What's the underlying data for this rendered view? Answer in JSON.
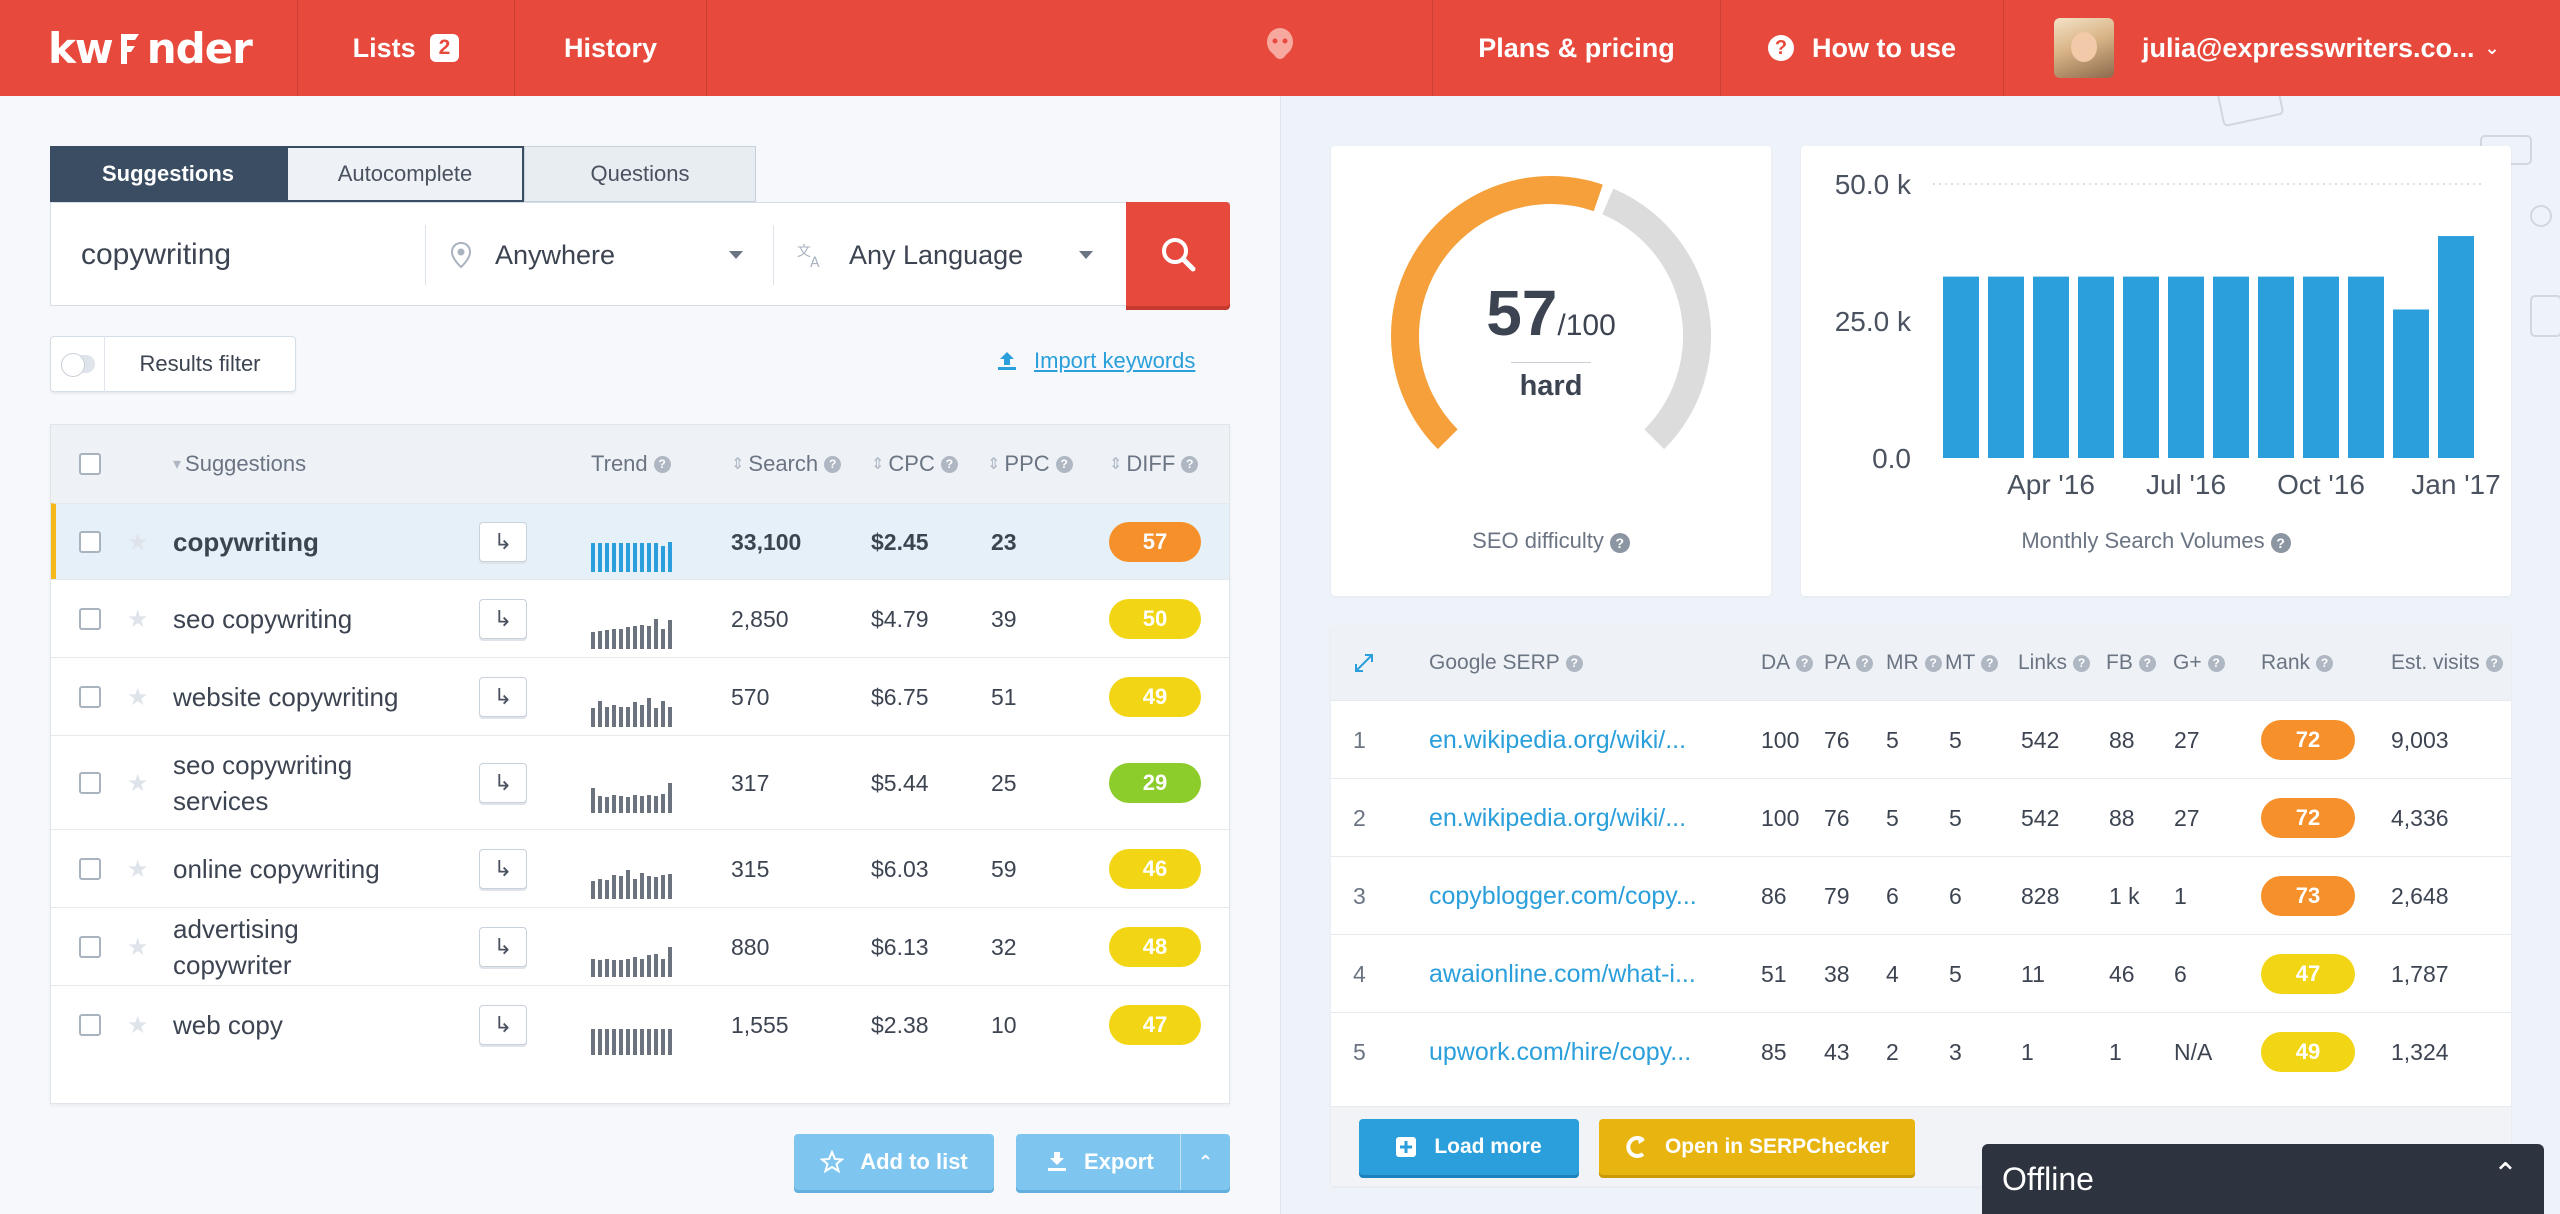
{
  "header": {
    "logo_text": "kwFinder",
    "nav": {
      "lists_label": "Lists",
      "lists_count": "2",
      "history_label": "History",
      "plans_label": "Plans & pricing",
      "howto_label": "How to use",
      "user_email": "julia@expresswriters.co..."
    },
    "brand_color": "#e8493d"
  },
  "search": {
    "tabs": [
      "Suggestions",
      "Autocomplete",
      "Questions"
    ],
    "active_tab": "Suggestions",
    "keyword": "copywriting",
    "location": "Anywhere",
    "language": "Any Language"
  },
  "filter": {
    "label": "Results filter",
    "import_label": "Import keywords"
  },
  "suggestions_table": {
    "columns": {
      "suggestions": "Suggestions",
      "trend": "Trend",
      "search": "Search",
      "cpc": "CPC",
      "ppc": "PPC",
      "diff": "DIFF"
    },
    "rows": [
      {
        "keyword": "copywriting",
        "search": "33,100",
        "cpc": "$2.45",
        "ppc": "23",
        "diff": "57",
        "diff_color": "#f5902a",
        "selected": true,
        "trend": [
          0.95,
          0.95,
          0.95,
          0.95,
          0.95,
          0.95,
          0.95,
          0.95,
          0.95,
          0.95,
          0.82,
          1.0
        ]
      },
      {
        "keyword": "seo copywriting",
        "search": "2,850",
        "cpc": "$4.79",
        "ppc": "39",
        "diff": "50",
        "diff_color": "#f2d616",
        "selected": false,
        "trend": [
          0.45,
          0.5,
          0.55,
          0.6,
          0.6,
          0.65,
          0.7,
          0.75,
          0.7,
          1.0,
          0.6,
          0.95
        ]
      },
      {
        "keyword": "website copywriting",
        "search": "570",
        "cpc": "$6.75",
        "ppc": "51",
        "diff": "49",
        "diff_color": "#f2d616",
        "selected": false,
        "trend": [
          0.55,
          0.85,
          0.6,
          0.65,
          0.6,
          0.6,
          0.8,
          0.65,
          0.95,
          0.55,
          0.85,
          0.6
        ]
      },
      {
        "keyword": "seo copywriting services",
        "search": "317",
        "cpc": "$5.44",
        "ppc": "25",
        "diff": "29",
        "diff_color": "#8ccc2b",
        "selected": false,
        "trend": [
          0.8,
          0.45,
          0.4,
          0.5,
          0.45,
          0.4,
          0.5,
          0.45,
          0.5,
          0.45,
          0.55,
          1.0
        ]
      },
      {
        "keyword": "online copywriting",
        "search": "315",
        "cpc": "$6.03",
        "ppc": "59",
        "diff": "46",
        "diff_color": "#f2d616",
        "selected": false,
        "trend": [
          0.5,
          0.6,
          0.55,
          0.75,
          0.7,
          0.95,
          0.6,
          0.85,
          0.7,
          0.65,
          0.75,
          0.8
        ]
      },
      {
        "keyword": "advertising copywriter",
        "search": "880",
        "cpc": "$6.13",
        "ppc": "32",
        "diff": "48",
        "diff_color": "#f2d616",
        "selected": false,
        "trend": [
          0.5,
          0.45,
          0.5,
          0.45,
          0.45,
          0.5,
          0.6,
          0.5,
          0.65,
          0.7,
          0.5,
          1.0
        ]
      },
      {
        "keyword": "web copy",
        "search": "1,555",
        "cpc": "$2.38",
        "ppc": "10",
        "diff": "47",
        "diff_color": "#f2d616",
        "selected": false,
        "trend": [
          0.85,
          0.85,
          0.85,
          0.85,
          0.85,
          0.85,
          0.85,
          0.85,
          0.85,
          0.85,
          0.85,
          0.85
        ]
      }
    ]
  },
  "actions": {
    "add_to_list": "Add to list",
    "export": "Export"
  },
  "seo_difficulty": {
    "value": 57,
    "max_label": "/100",
    "level": "hard",
    "caption": "SEO difficulty",
    "gauge_color": "#f5a03a",
    "track_color": "#dcdcdc"
  },
  "chart_data": {
    "type": "bar",
    "categories": [
      "",
      "",
      "",
      "",
      "",
      "",
      "",
      "",
      "",
      "",
      "",
      ""
    ],
    "x_tick_labels": [
      "Apr '16",
      "Jul '16",
      "Oct '16",
      "Jan '17"
    ],
    "values": [
      33100,
      33100,
      33100,
      33100,
      33100,
      33100,
      33100,
      33100,
      33100,
      33100,
      27100,
      40500
    ],
    "yticks": [
      "50.0 k",
      "25.0 k",
      "0.0"
    ],
    "ylim": [
      0,
      50000
    ],
    "bar_color": "#2a9fdb",
    "caption": "Monthly Search Volumes"
  },
  "serp": {
    "columns": {
      "title": "Google SERP",
      "da": "DA",
      "pa": "PA",
      "mr": "MR",
      "mt": "MT",
      "links": "Links",
      "fb": "FB",
      "gplus": "G+",
      "rank": "Rank",
      "visits": "Est. visits"
    },
    "rows": [
      {
        "pos": "1",
        "url": "en.wikipedia.org/wiki/...",
        "da": "100",
        "pa": "76",
        "mr": "5",
        "mt": "5",
        "links": "542",
        "fb": "88",
        "gplus": "27",
        "rank": "72",
        "rank_color": "#f5902a",
        "visits": "9,003"
      },
      {
        "pos": "2",
        "url": "en.wikipedia.org/wiki/...",
        "da": "100",
        "pa": "76",
        "mr": "5",
        "mt": "5",
        "links": "542",
        "fb": "88",
        "gplus": "27",
        "rank": "72",
        "rank_color": "#f5902a",
        "visits": "4,336"
      },
      {
        "pos": "3",
        "url": "copyblogger.com/copy...",
        "da": "86",
        "pa": "79",
        "mr": "6",
        "mt": "6",
        "links": "828",
        "fb": "1 k",
        "gplus": "1",
        "rank": "73",
        "rank_color": "#f5902a",
        "visits": "2,648"
      },
      {
        "pos": "4",
        "url": "awaionline.com/what-i...",
        "da": "51",
        "pa": "38",
        "mr": "4",
        "mt": "5",
        "links": "11",
        "fb": "46",
        "gplus": "6",
        "rank": "47",
        "rank_color": "#f2d616",
        "visits": "1,787"
      },
      {
        "pos": "5",
        "url": "upwork.com/hire/copy...",
        "da": "85",
        "pa": "43",
        "mr": "2",
        "mt": "3",
        "links": "1",
        "fb": "1",
        "gplus": "N/A",
        "rank": "49",
        "rank_color": "#f2d616",
        "visits": "1,324"
      }
    ],
    "load_more": "Load more",
    "open_serpchecker": "Open in SERPChecker"
  },
  "offline": {
    "label": "Offline"
  }
}
